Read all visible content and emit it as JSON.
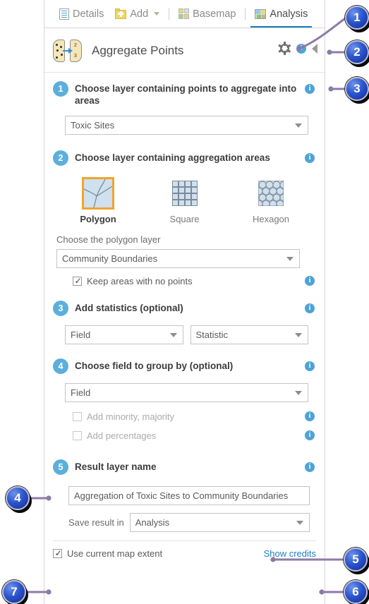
{
  "tabbar": {
    "tabs": [
      {
        "label": "Details",
        "icon": "details-icon",
        "active": false
      },
      {
        "label": "Add",
        "icon": "add-folder-icon",
        "active": false,
        "has_caret": true
      },
      {
        "label": "Basemap",
        "icon": "basemap-grid-icon",
        "active": false
      },
      {
        "label": "Analysis",
        "icon": "analysis-map-icon",
        "active": true
      }
    ]
  },
  "tool": {
    "title": "Aggregate Points",
    "icon": "aggregate-points-icon",
    "settings_icon": "gear-icon",
    "info_icon": "info-icon",
    "collapse_icon": "collapse-left-triangle-icon"
  },
  "steps": {
    "step1": {
      "number": "1",
      "label": "Choose layer containing points to aggregate into areas",
      "layer_select": {
        "value": "Toxic Sites"
      }
    },
    "step2": {
      "number": "2",
      "label": "Choose layer containing aggregation areas",
      "shapes": [
        {
          "label": "Polygon",
          "icon": "polygon-shape-icon",
          "selected": true
        },
        {
          "label": "Square",
          "icon": "square-grid-icon",
          "selected": false
        },
        {
          "label": "Hexagon",
          "icon": "hexagon-grid-icon",
          "selected": false
        }
      ],
      "polygon_layer_label": "Choose the polygon layer",
      "polygon_select": {
        "value": "Community Boundaries"
      },
      "keep_areas_checkbox": {
        "label": "Keep areas with no points",
        "checked": true
      }
    },
    "step3": {
      "number": "3",
      "label": "Add statistics (optional)",
      "field_select": {
        "value": "Field"
      },
      "statistic_select": {
        "value": "Statistic"
      }
    },
    "step4": {
      "number": "4",
      "label": "Choose field to group by (optional)",
      "field_select": {
        "value": "Field"
      },
      "minority_checkbox": {
        "label": "Add minority, majority",
        "checked": false
      },
      "percentages_checkbox": {
        "label": "Add percentages",
        "checked": false
      }
    },
    "step5": {
      "number": "5",
      "label": "Result layer name",
      "result_name": {
        "value": "Aggregation of Toxic Sites to Community Boundaries"
      },
      "save_label": "Save result in",
      "save_select": {
        "value": "Analysis"
      }
    }
  },
  "footer": {
    "map_extent_checkbox": {
      "label": "Use current map extent",
      "checked": true
    },
    "show_credits": "Show credits"
  },
  "callouts": [
    {
      "id": "1",
      "number": "1"
    },
    {
      "id": "2",
      "number": "2"
    },
    {
      "id": "3",
      "number": "3"
    },
    {
      "id": "4",
      "number": "4"
    },
    {
      "id": "5",
      "number": "5"
    },
    {
      "id": "6",
      "number": "6"
    },
    {
      "id": "7",
      "number": "7"
    }
  ],
  "colors": {
    "accent_blue": "#1a7dbd",
    "step_badge": "#5cafdc",
    "info_blue": "#4da3d6",
    "selected_orange": "#f2a42a",
    "callout_blue": "#2b56cf",
    "leader_purple": "#8d7aa8",
    "link_blue": "#1c7ec0"
  }
}
